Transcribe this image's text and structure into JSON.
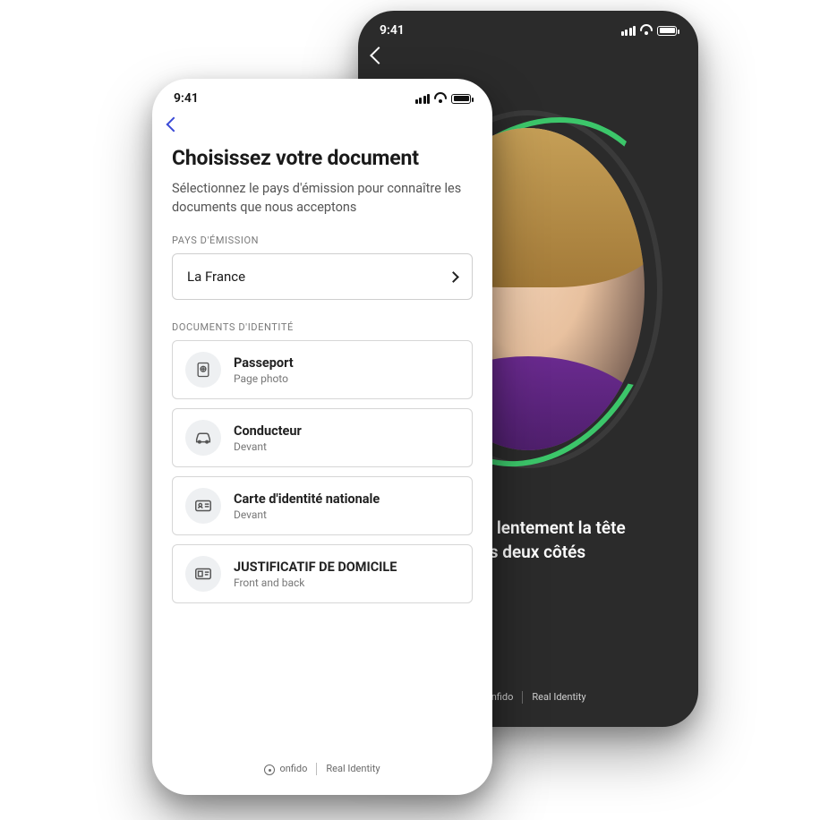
{
  "statusbar": {
    "time": "9:41"
  },
  "back_phone": {
    "instruction_line1": "Tournez lentement la tête",
    "instruction_line2": "des deux côtés"
  },
  "front_phone": {
    "title": "Choisissez votre document",
    "subtitle": "Sélectionnez le pays d'émission pour connaître les documents que nous acceptons",
    "country_label": "PAYS D'ÉMISSION",
    "country_value": "La France",
    "documents_label": "DOCUMENTS D'IDENTITÉ",
    "documents": [
      {
        "name": "Passeport",
        "sub": "Page photo"
      },
      {
        "name": "Conducteur",
        "sub": "Devant"
      },
      {
        "name": "Carte d'identité nationale",
        "sub": "Devant"
      },
      {
        "name": "JUSTIFICATIF DE DOMICILE",
        "sub": "Front and back"
      }
    ]
  },
  "branding": {
    "company": "onfido",
    "tagline": "Real Identity"
  }
}
